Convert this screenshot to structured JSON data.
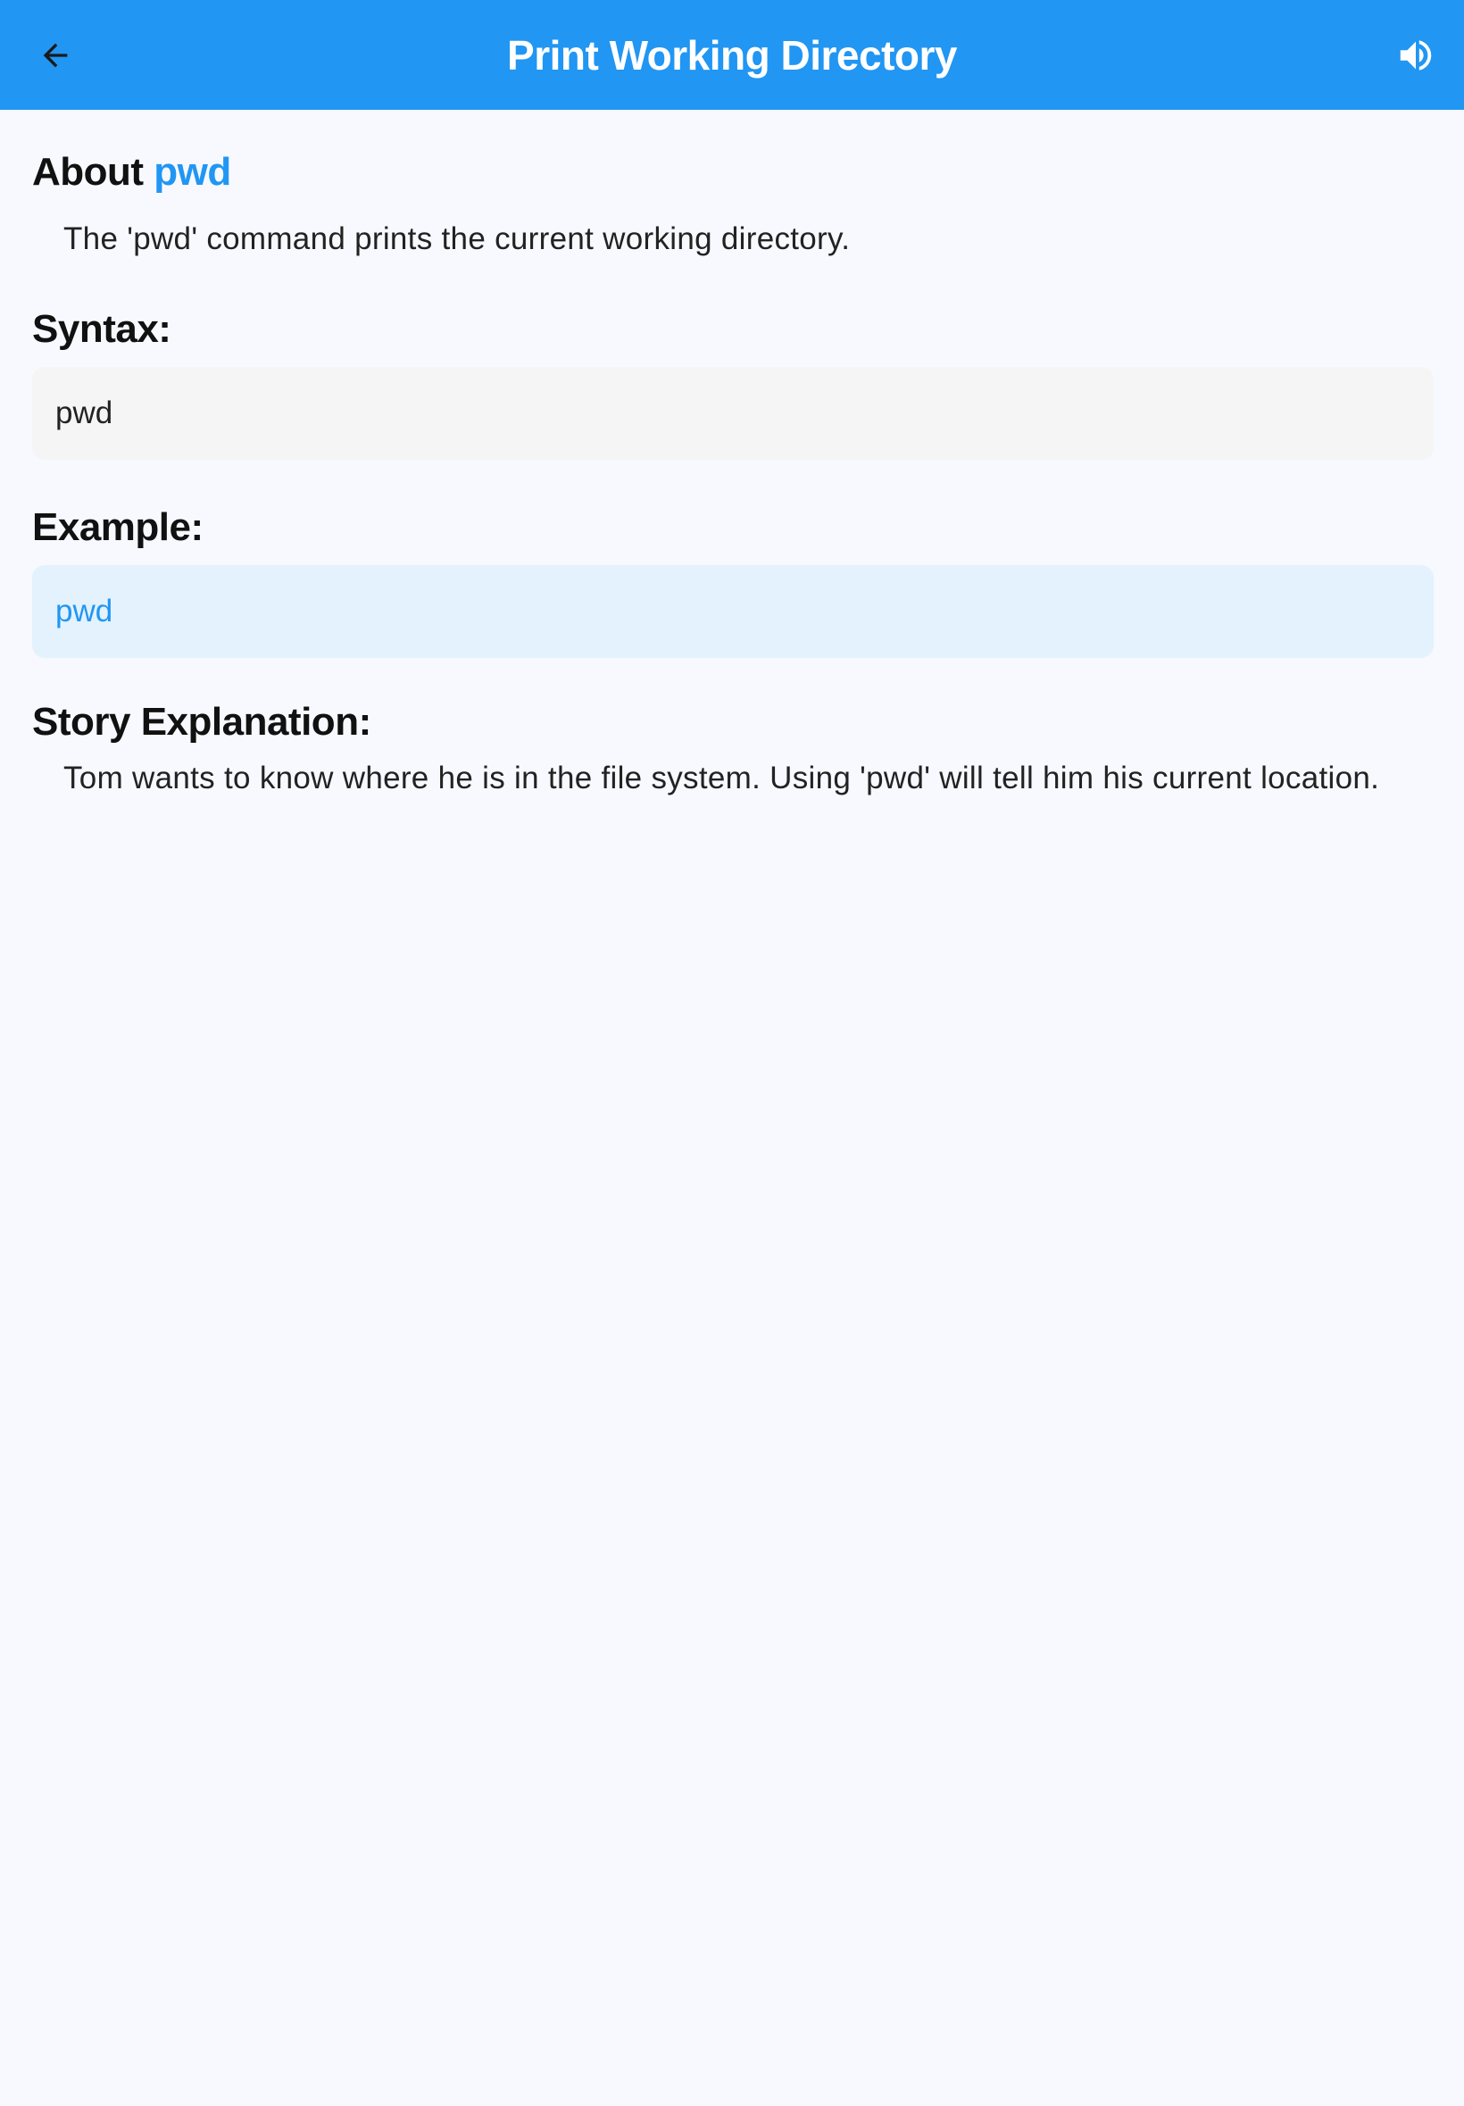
{
  "app_bar": {
    "title": "Print Working Directory",
    "background_color": "#2196f3",
    "back_icon": "arrow-left-icon",
    "speaker_icon": "volume-up-icon"
  },
  "about": {
    "heading_prefix": "About",
    "command": "pwd",
    "description": "The 'pwd' command prints the current working directory."
  },
  "syntax": {
    "heading": "Syntax:",
    "code": "pwd"
  },
  "example": {
    "heading": "Example:",
    "code": "pwd"
  },
  "story": {
    "heading": "Story Explanation:",
    "text": "Tom wants to know where he is in the file system. Using 'pwd' will tell him his current location."
  },
  "colors": {
    "accent": "#2196f3",
    "page_background": "#f7f9fe",
    "syntax_box": "#f5f5f5",
    "example_box": "#e3f2fd"
  }
}
